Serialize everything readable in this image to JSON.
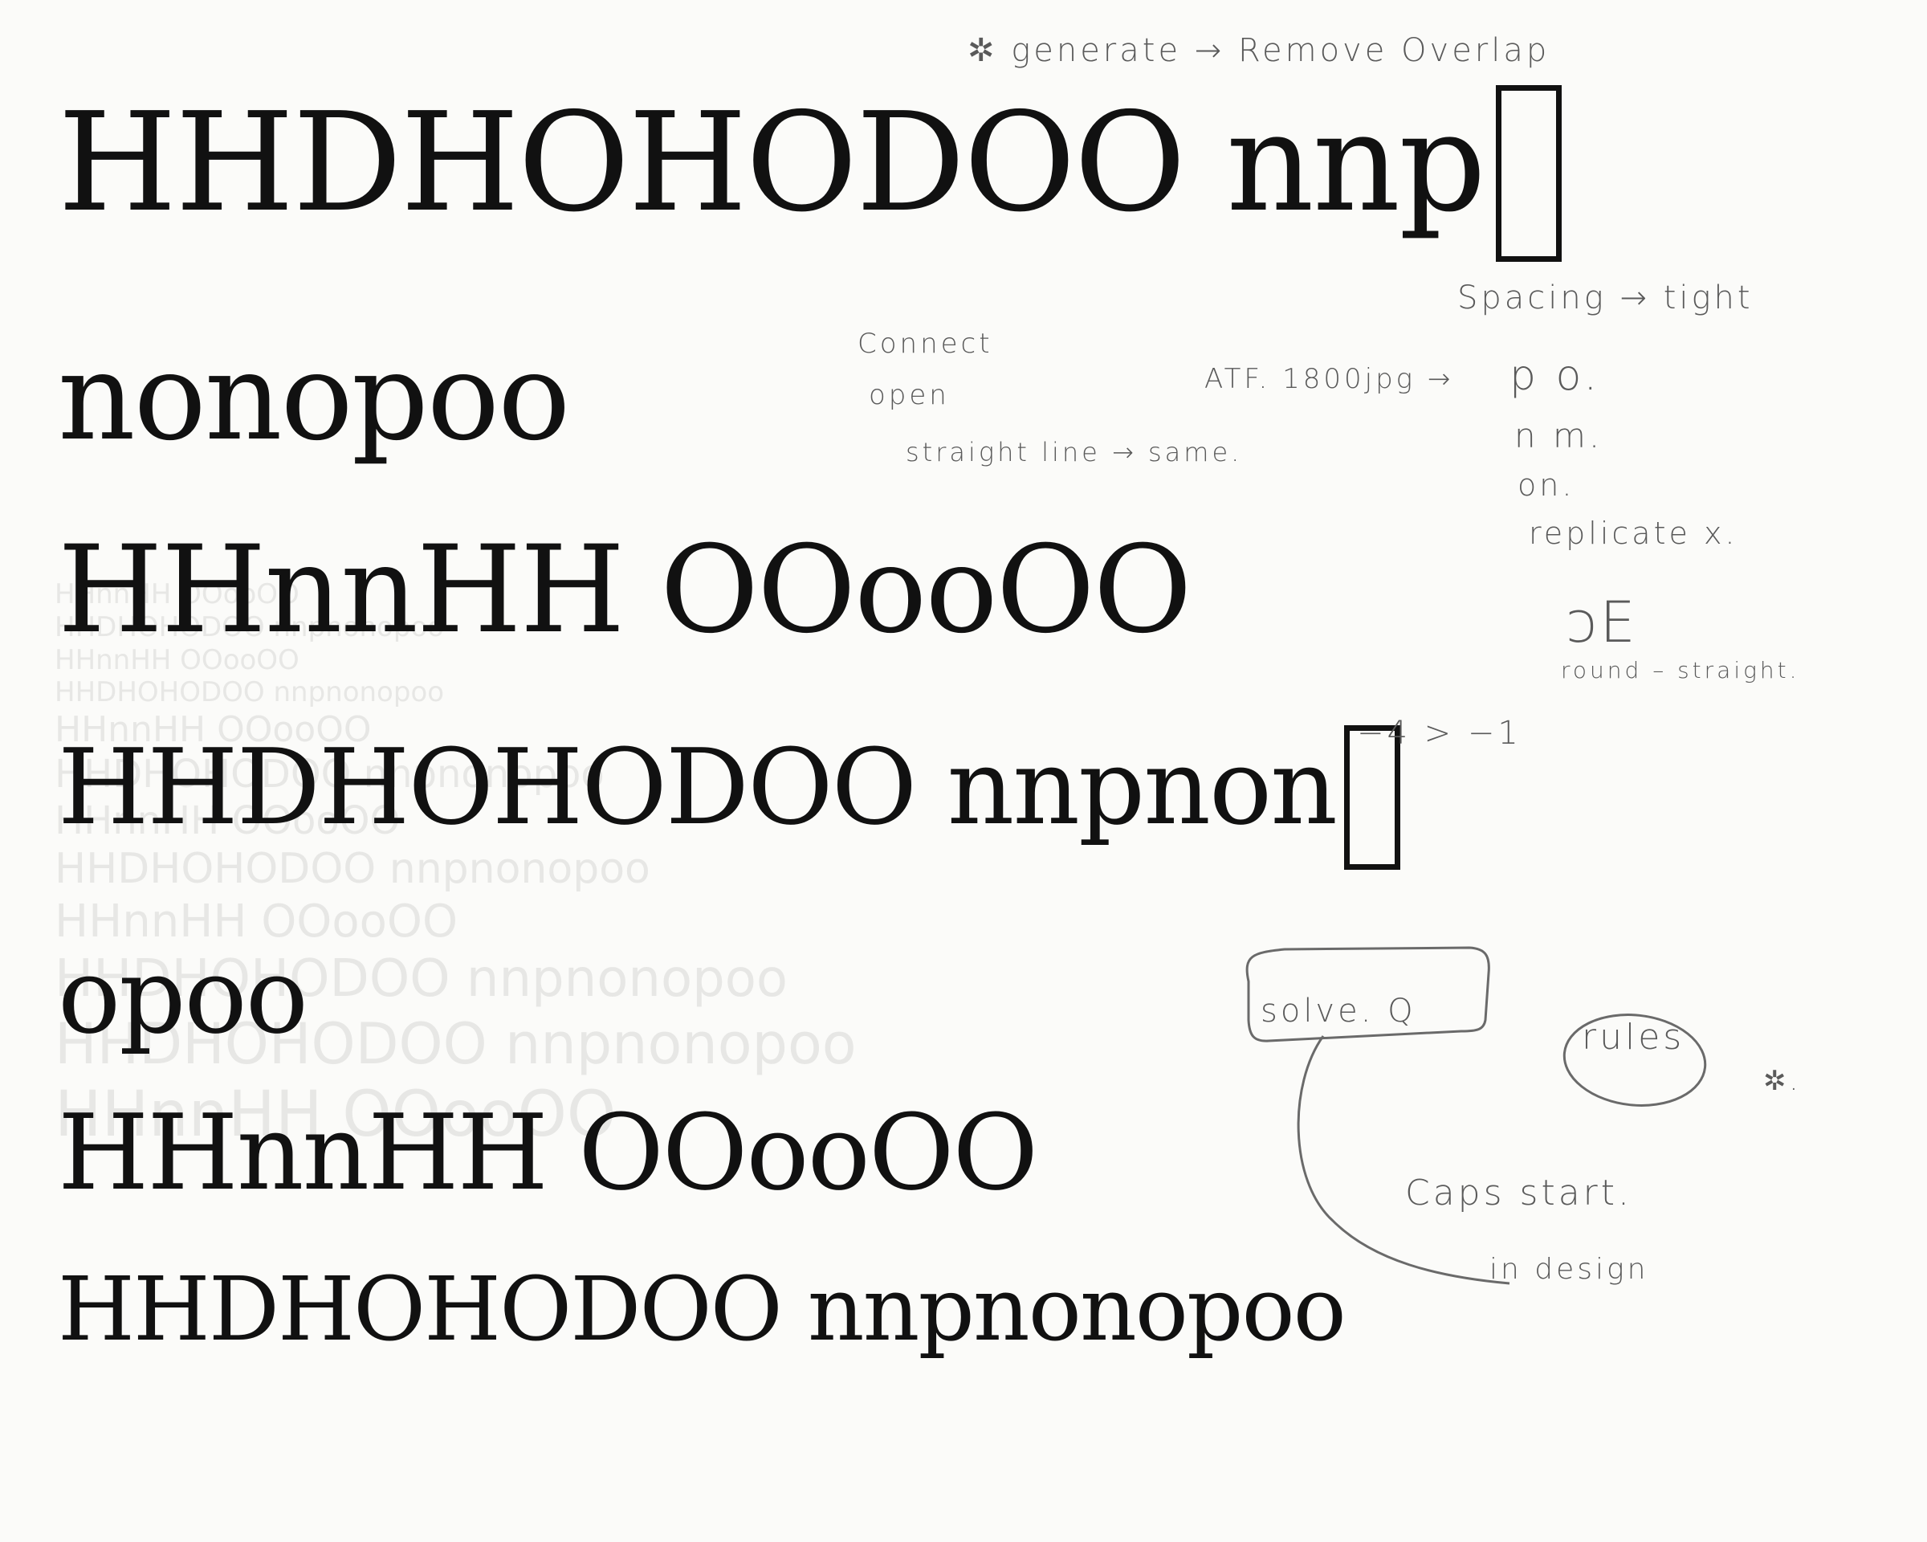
{
  "specimen_lines": [
    {
      "text": "HHDHOHODOO  nnp"
    },
    {
      "text": "nonopoo"
    },
    {
      "text": "HHnnHH  OOooOO"
    },
    {
      "text": "HHDHOHODOO  nnpnon"
    },
    {
      "text": "opoo"
    },
    {
      "text": "HHnnHH  OOooOO"
    },
    {
      "text": "HHDHOHODOO  nnpnonopoo"
    }
  ],
  "ghost_lines": [
    "HHnnHH OOooOO",
    "HHDHOHODOO nnpnonopoo",
    "HHnnHH OOooOO",
    "HHDHOHODOO nnpnonopoo",
    "HHnnHH OOooOO",
    "HHDHOHODOO nnpnonopoo",
    "HHnnHH OOooOO",
    "HHDHOHODOO nnpnonopoo",
    "HHnnHH OOooOO",
    "HHDHOHODOO nnpnonopoo",
    "HHDHOHODOO nnpnonopoo",
    "HHnnHH OOooOO"
  ],
  "notes": {
    "generate": "✲ generate →  Remove Overlap",
    "spacing": "Spacing → tight",
    "connect": "Connect",
    "open": "open",
    "straight": "straight line → same.",
    "atf": "ATF.   1800jpg →",
    "po": "p o.",
    "nm": "n m.",
    "on": "on.",
    "replicate": "replicate x.",
    "de": "ↄE",
    "round": "round – straight.",
    "minus": "−4 > −1",
    "solve": "solve. Q",
    "rules": "rules",
    "star": "✲.",
    "caps": "Caps start.",
    "indesign": "in design"
  }
}
